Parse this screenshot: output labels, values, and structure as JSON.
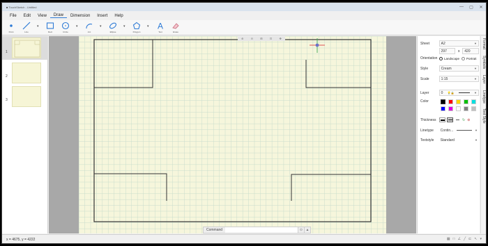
{
  "app": {
    "title": "■ TouchSketch - Untitled",
    "controls": [
      "—",
      "▢",
      "✕"
    ]
  },
  "menu": [
    "File",
    "Edit",
    "View",
    "Draw",
    "Dimension",
    "Insert",
    "Help"
  ],
  "menu_active": "Draw",
  "toolbar": [
    {
      "name": "point-icon",
      "label": "Point"
    },
    {
      "name": "line-icon",
      "label": "Line"
    },
    {
      "name": "rectangle-icon",
      "label": "Rect"
    },
    {
      "name": "circle-icon",
      "label": "Circle"
    },
    {
      "name": "arc-icon",
      "label": "Arc"
    },
    {
      "name": "ellipse-icon",
      "label": "Ellipse"
    },
    {
      "name": "polygon-icon",
      "label": "Polygon"
    },
    {
      "name": "text-icon",
      "label": "Text"
    },
    {
      "name": "eraser-icon",
      "label": "Erase"
    }
  ],
  "pages": [
    "1",
    "2",
    "3"
  ],
  "zoom_controls": [
    "⊕",
    "⊖",
    "⊞",
    "⊡",
    "✥"
  ],
  "command": {
    "label": "Command",
    "buttons": [
      "⊙",
      "▲"
    ]
  },
  "props": {
    "sheet_label": "Sheet",
    "sheet_value": "A2",
    "width": "297",
    "x_sep": "x",
    "height": "420",
    "orientation_label": "Orientation",
    "orientation_landscape": "Landscape",
    "orientation_portrait": "Portrait",
    "style_label": "Style",
    "style_value": "Cream",
    "scale_label": "Scale",
    "scale_value": "1:15",
    "layer_label": "Layer",
    "layer_value": "0",
    "color_label": "Color",
    "thickness_label": "Thickness",
    "linetype_label": "Linetype",
    "linetype_value": "Contin...",
    "textstyle_label": "Textstyle",
    "textstyle_value": "Standard"
  },
  "colors": {
    "row1": [
      "#000000",
      "#ff0000",
      "#ffd800",
      "#00c000",
      "#00e0e0"
    ],
    "row2": [
      "#0000ff",
      "#e000e0",
      "#ffffff",
      "#808080",
      "#c0c0c0"
    ]
  },
  "side_tabs": [
    "Format",
    "Symbols",
    "Layer",
    "Linetype",
    "Text Style"
  ],
  "status": {
    "coords": "x = 4675, y = 4222",
    "icons": [
      "▦",
      "□",
      "∠",
      "╱",
      "⊏",
      "↖",
      "▾"
    ]
  }
}
